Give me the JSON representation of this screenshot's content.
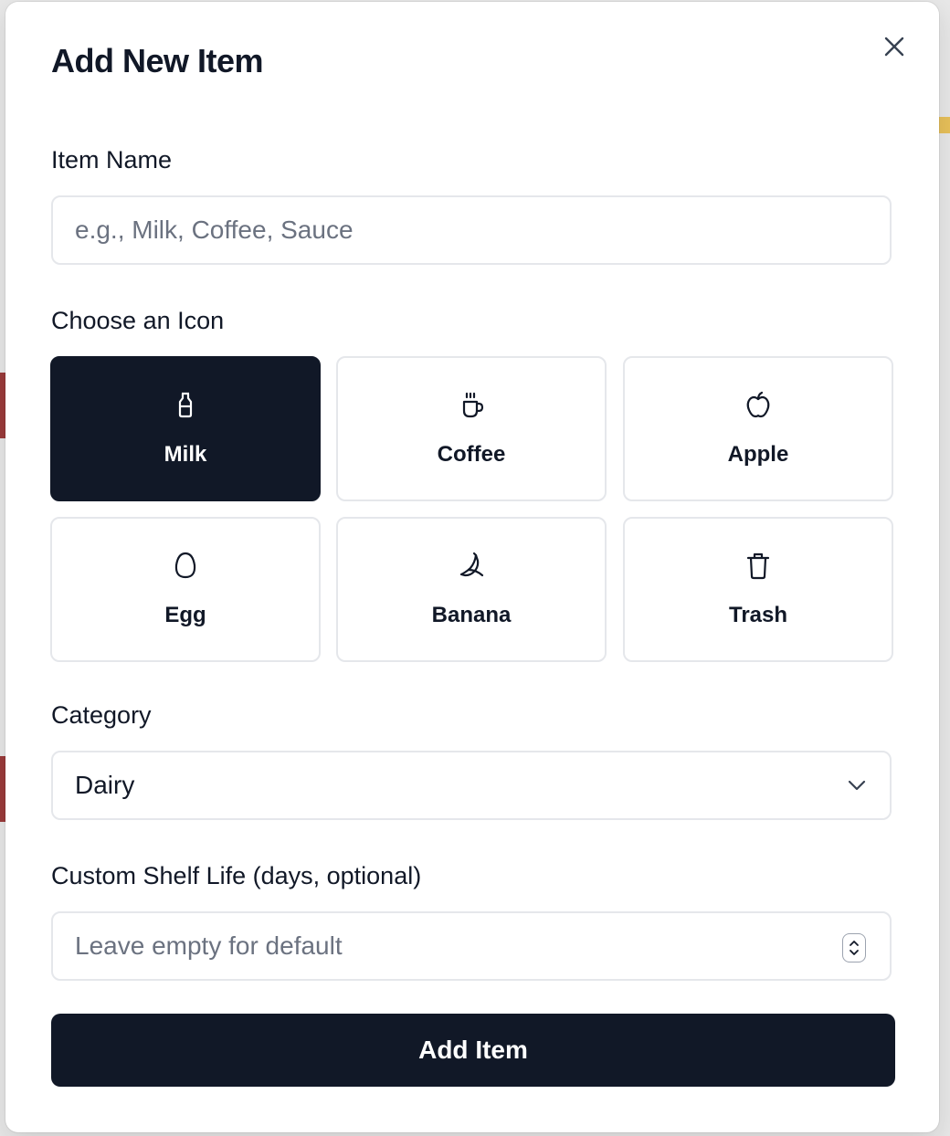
{
  "modal": {
    "title": "Add New Item"
  },
  "item_name": {
    "label": "Item Name",
    "value": "",
    "placeholder": "e.g., Milk, Coffee, Sauce"
  },
  "icon_picker": {
    "label": "Choose an Icon",
    "selected": "Milk",
    "options": [
      {
        "label": "Milk",
        "icon": "milk-bottle-icon",
        "selected": true
      },
      {
        "label": "Coffee",
        "icon": "coffee-cup-icon",
        "selected": false
      },
      {
        "label": "Apple",
        "icon": "apple-icon",
        "selected": false
      },
      {
        "label": "Egg",
        "icon": "egg-icon",
        "selected": false
      },
      {
        "label": "Banana",
        "icon": "banana-icon",
        "selected": false
      },
      {
        "label": "Trash",
        "icon": "trash-icon",
        "selected": false
      }
    ]
  },
  "category": {
    "label": "Category",
    "selected_value": "Dairy"
  },
  "shelf_life": {
    "label": "Custom Shelf Life (days, optional)",
    "value": "",
    "placeholder": "Leave empty for default"
  },
  "submit": {
    "label": "Add Item"
  },
  "colors": {
    "primary": "#111827",
    "border": "#e5e7eb",
    "placeholder": "#6b7280",
    "background": "#ffffff"
  }
}
